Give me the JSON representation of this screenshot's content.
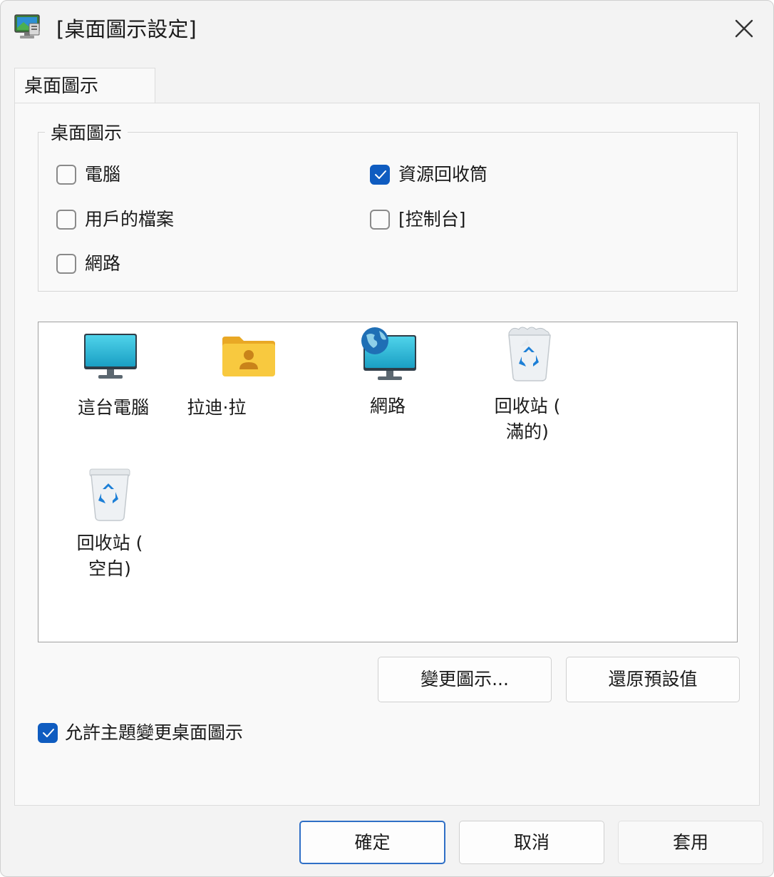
{
  "window": {
    "title": "[桌面圖示設定]"
  },
  "tab": {
    "label": "桌面圖示"
  },
  "group": {
    "title": "桌面圖示",
    "checkboxes": [
      {
        "label": "電腦",
        "checked": false
      },
      {
        "label": "資源回收筒",
        "checked": true
      },
      {
        "label": "用戶的檔案",
        "checked": false
      },
      {
        "label": "[控制台]",
        "checked": false
      },
      {
        "label": "網路",
        "checked": false
      }
    ]
  },
  "icons": [
    {
      "label": "這台電腦",
      "icon": "monitor-icon"
    },
    {
      "label": "拉迪·拉",
      "icon": "user-folder-icon"
    },
    {
      "label": "網路",
      "icon": "network-globe-icon"
    },
    {
      "label": "回收站 (\n滿的)",
      "icon": "recycle-bin-full-icon"
    },
    {
      "label": "回收站 (\n空白)",
      "icon": "recycle-bin-empty-icon"
    }
  ],
  "buttons": {
    "change_icon": "變更圖示...",
    "restore_default": "還原預設值",
    "ok": "確定",
    "cancel": "取消",
    "apply": "套用"
  },
  "allow_themes": {
    "label": "允許主題變更桌面圖示",
    "checked": true
  },
  "colors": {
    "accent": "#0f5cc0",
    "window_bg": "#f3f3f3",
    "panel_bg": "#f9f9f9"
  }
}
